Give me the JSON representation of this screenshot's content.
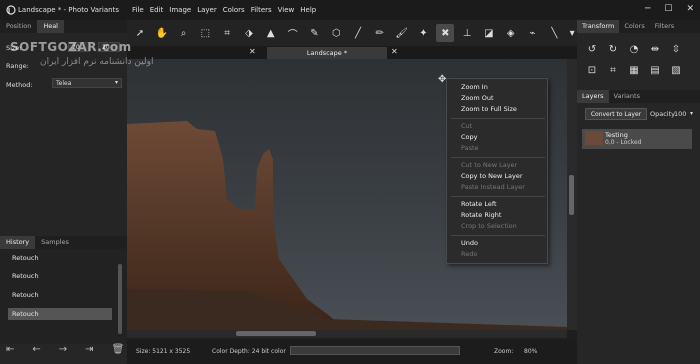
{
  "app": {
    "title": "Landscape * - Photo Variants"
  },
  "menubar": [
    "File",
    "Edit",
    "Image",
    "Layer",
    "Colors",
    "Filters",
    "View",
    "Help"
  ],
  "left_panel": {
    "tabs": [
      "Position",
      "Heal"
    ],
    "size_label": "Size:",
    "size_a": "20",
    "size_b": "20",
    "range_label": "Range:",
    "method_label": "Method:",
    "method_value": "Telea"
  },
  "history": {
    "tabs": [
      "History",
      "Samples"
    ],
    "items": [
      "Retouch",
      "Retouch",
      "Retouch",
      "Retouch"
    ]
  },
  "document": {
    "tab_title": "Landscape *"
  },
  "status": {
    "size": "Size: 5121 x 3525",
    "depth": "Color Depth: 24 bit color",
    "zoom_label": "Zoom:",
    "zoom_value": "80%"
  },
  "context_menu": {
    "zoom_in": "Zoom In",
    "zoom_out": "Zoom Out",
    "zoom_full": "Zoom to Full Size",
    "cut": "Cut",
    "copy": "Copy",
    "paste": "Paste",
    "cut_new_layer": "Cut to New Layer",
    "copy_new_layer": "Copy to New Layer",
    "paste_instead": "Paste Instead Layer",
    "rotate_left": "Rotate Left",
    "rotate_right": "Rotate Right",
    "crop_selection": "Crop to Selection",
    "undo": "Undo",
    "redo": "Redo"
  },
  "right_panel": {
    "tabs": [
      "Transform",
      "Colors",
      "Filters"
    ],
    "layer_tabs": [
      "Layers",
      "Variants"
    ],
    "convert_button": "Convert to Layer",
    "opacity_label": "Opacity",
    "opacity_value": "100",
    "layer": {
      "name": "Testing",
      "info": "0,0 - Locked"
    }
  },
  "watermark": {
    "line1": "SOFTGOZAR.com",
    "line2": "اولین دانشنامه نرم افزار ایران"
  }
}
